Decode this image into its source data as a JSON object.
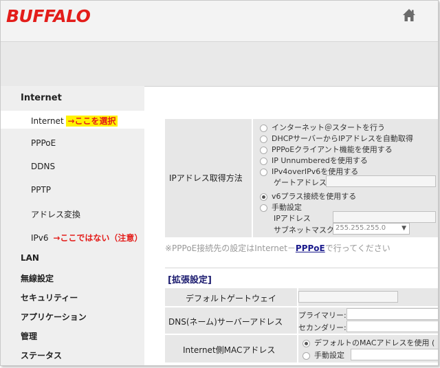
{
  "brand": {
    "logo_text": "BUFFALO",
    "accent": "#e31d1a"
  },
  "header": {
    "home_icon": "home-icon"
  },
  "sidebar": {
    "section_heading": "Internet",
    "items": [
      {
        "label": "Internet",
        "note": "→ここを選択",
        "active": true
      },
      {
        "label": "PPPoE"
      },
      {
        "label": "DDNS"
      },
      {
        "label": "PPTP"
      },
      {
        "label": "アドレス変換"
      },
      {
        "label": "IPv6",
        "note": "→ここではない（注意）"
      }
    ],
    "top_items": [
      "LAN",
      "無線設定",
      "セキュリティー",
      "アプリケーション",
      "管理",
      "ステータス"
    ]
  },
  "ip_method": {
    "label": "IPアドレス取得方法",
    "options": [
      "インターネット＠スタートを行う",
      "DHCPサーバーからIPアドレスを自動取得",
      "PPPoEクライアント機能を使用する",
      "IP Unnumberedを使用する",
      "IPv4overIPv6を使用する",
      "v6プラス接続を使用する",
      "手動設定"
    ],
    "selected_index": 5,
    "gateway_label": "ゲートアドレス",
    "ip_label": "IPアドレス",
    "subnet_label": "サブネットマスク",
    "subnet_value": "255.255.255.0"
  },
  "footnote": {
    "prefix": "※PPPoE接続先の設定はInternet－",
    "link": "PPPoE",
    "suffix": "で行ってください"
  },
  "advanced": {
    "title": "[拡張設定]",
    "default_gateway_label": "デフォルトゲートウェイ",
    "dns_label": "DNS(ネーム)サーバーアドレス",
    "dns_primary": "プライマリー:",
    "dns_secondary": "セカンダリー:",
    "mac_label": "Internet側MACアドレス",
    "mac_options": [
      "デフォルトのMACアドレスを使用 (",
      "手動設定"
    ],
    "mac_selected_index": 0
  }
}
